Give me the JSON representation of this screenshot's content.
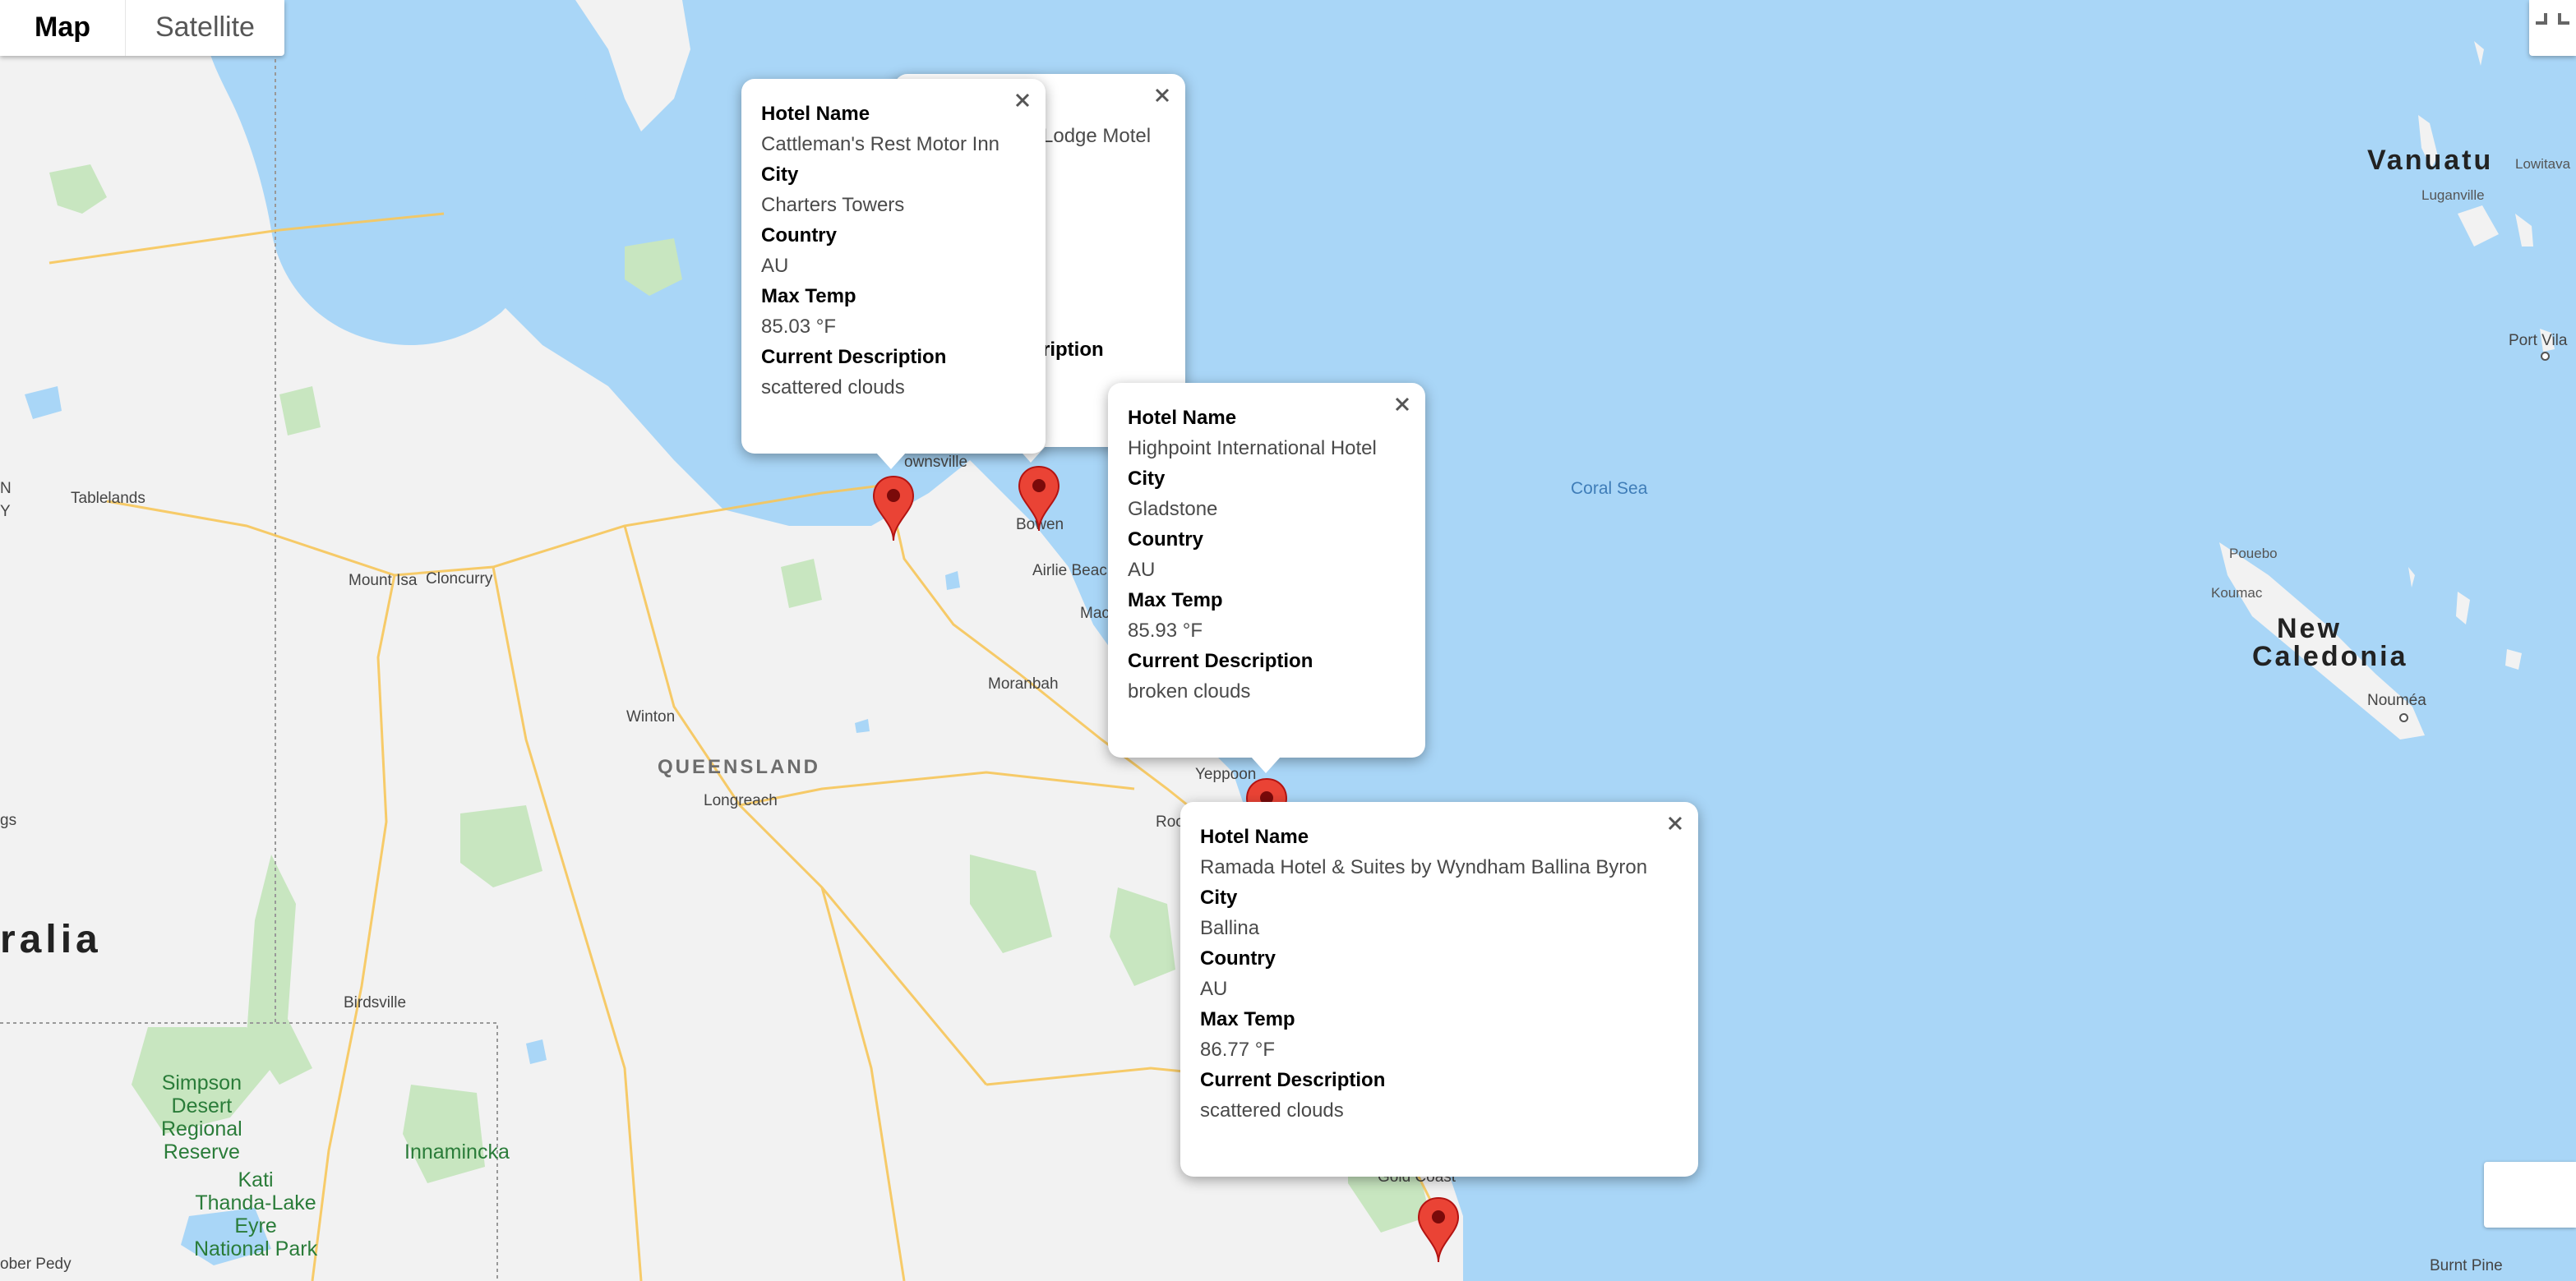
{
  "map_type_control": {
    "map_label": "Map",
    "satellite_label": "Satellite"
  },
  "labels": {
    "vanuatu": "Vanuatu",
    "lowitavai": "Lowitava",
    "luganville": "Luganville",
    "port_vila": "Port Vila",
    "coral_sea": "Coral Sea",
    "new_caledonia_1": "New",
    "new_caledonia_2": "Caledonia",
    "poueb": "Pouebo",
    "koumac": "Koumac",
    "noumea": "Nouméa",
    "queensland": "QUEENSLAND",
    "australia": "ralia",
    "tablelands": "Tablelands",
    "mount_isa": "Mount Isa",
    "cloncurry": "Cloncurry",
    "winton": "Winton",
    "longreach": "Longreach",
    "moranbah": "Moranbah",
    "townsville": "ownsville",
    "bowen": "Bowen",
    "airlie_beach": "Airlie Beach",
    "mackay": "Mac",
    "yeppoon": "Yeppoon",
    "rockhampton": "Roc",
    "birdsville": "Birdsville",
    "simpson": "Simpson\nDesert\nRegional\nReserve",
    "innamincka": "Innamincka",
    "kati": "Kati\nThanda-Lake\nEyre\nNational Park",
    "coober_pedy": "ober Pedy",
    "gold_coast": "Gold Coast",
    "burnt_pine": "Burnt Pine",
    "left_n": "N",
    "left_y": "Y",
    "left_gs": "gs"
  },
  "info_windows": [
    {
      "hotel_name_label": "Hotel Name",
      "hotel_name": "Cattleman's Rest Motor Inn",
      "city_label": "City",
      "city": "Charters Towers",
      "country_label": "Country",
      "country": "AU",
      "max_temp_label": "Max Temp",
      "max_temp": "85.03 °F",
      "description_label": "Current Description",
      "description": "scattered clouds"
    },
    {
      "hotel_name_partial": "Lodge Motel",
      "description_label_partial": "ription"
    },
    {
      "hotel_name_label": "Hotel Name",
      "hotel_name": "Highpoint International Hotel",
      "city_label": "City",
      "city": "Gladstone",
      "country_label": "Country",
      "country": "AU",
      "max_temp_label": "Max Temp",
      "max_temp": "85.93 °F",
      "description_label": "Current Description",
      "description": "broken clouds"
    },
    {
      "hotel_name_label": "Hotel Name",
      "hotel_name": "Ramada Hotel & Suites by Wyndham Ballina Byron",
      "city_label": "City",
      "city": "Ballina",
      "country_label": "Country",
      "country": "AU",
      "max_temp_label": "Max Temp",
      "max_temp": "86.77 °F",
      "description_label": "Current Description",
      "description": "scattered clouds"
    }
  ],
  "colors": {
    "water": "#a9d6f7",
    "land": "#f2f2f2",
    "park": "#c8e6c0",
    "road": "#f7c65a",
    "pin": "#ea4335"
  }
}
